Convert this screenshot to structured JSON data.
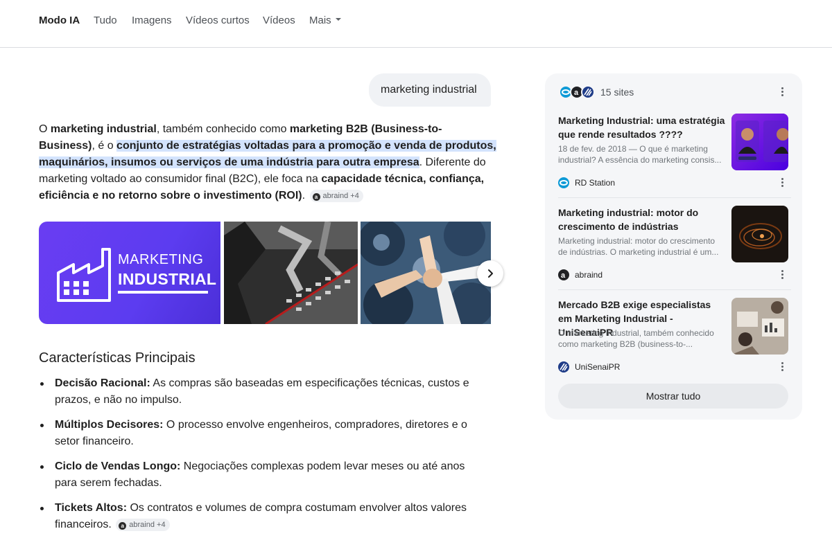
{
  "nav": {
    "tabs": [
      {
        "label": "Modo IA"
      },
      {
        "label": "Tudo"
      },
      {
        "label": "Imagens"
      },
      {
        "label": "Vídeos curtos"
      },
      {
        "label": "Vídeos"
      },
      {
        "label": "Mais"
      }
    ]
  },
  "query": "marketing industrial",
  "answer": {
    "p1": "O ",
    "b1": "marketing industrial",
    "p2": ", também conhecido como ",
    "b2": "marketing B2B (Business-to-Business)",
    "p3": ", é o ",
    "b3": "conjunto de estratégias voltadas para a promoção e venda de produtos, maquinários, insumos ou serviços de uma indústria para outra empresa",
    "p4": ". Diferente do marketing voltado ao consumidor final (B2C), ele foca na ",
    "b4": "capacidade técnica, confiança, eficiência e no retorno sobre o investimento (ROI)",
    "p5": ".",
    "chip_label": "abraind +4"
  },
  "images": {
    "img1_line1": "MARKETING",
    "img1_line2": "INDUSTRIAL"
  },
  "characteristics": {
    "title": "Características Principais",
    "items": [
      {
        "term": "Decisão Racional:",
        "text": " As compras são baseadas em especificações técnicas, custos e prazos, e não no impulso."
      },
      {
        "term": "Múltiplos Decisores:",
        "text": " O processo envolve engenheiros, compradores, diretores e o setor financeiro."
      },
      {
        "term": "Ciclo de Vendas Longo:",
        "text": " Negociações complexas podem levar meses ou até anos para serem fechadas."
      },
      {
        "term": "Tickets Altos:",
        "text": " Os contratos e volumes de compra costumam envolver altos valores financeiros."
      }
    ],
    "chip_label": "abraind +4"
  },
  "sources": {
    "count_label": "15 sites",
    "items": [
      {
        "title": "Marketing Industrial: uma estratégia que rende resultados ????",
        "snippet": "18 de fev. de 2018 — O que é marketing industrial? A essência do marketing consis...",
        "site": "RD Station"
      },
      {
        "title": "Marketing industrial: motor do crescimento de indústrias",
        "snippet": "Marketing industrial: motor do crescimento de indústrias. O marketing industrial é um...",
        "site": "abraind"
      },
      {
        "title": "Mercado B2B exige especialistas em Marketing Industrial - UniSenaiPR",
        "snippet": "O marketing industrial, também conhecido como marketing B2B (business-to-...",
        "site": "UniSenaiPR"
      }
    ],
    "show_all_label": "Mostrar tudo"
  },
  "colors": {
    "highlight": "#d3e3fd",
    "accent_purple": "#5c3cf0",
    "panel_bg": "#f5f6f8"
  }
}
